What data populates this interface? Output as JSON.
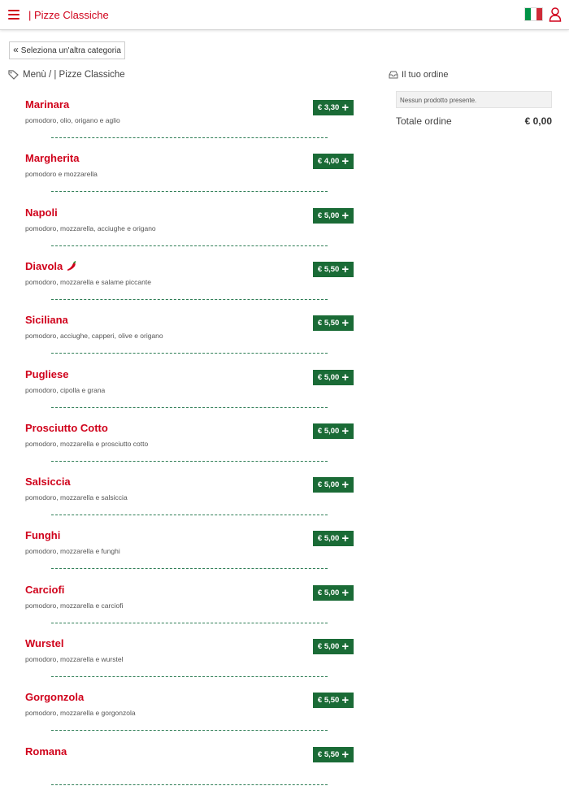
{
  "header": {
    "title": "| Pizze Classiche",
    "menu_icon": "hamburger-menu-icon",
    "flag_icon": "italian-flag-icon",
    "user_icon": "user-icon"
  },
  "category_button": {
    "chevron": "«",
    "label": "Seleziona un'altra categoria"
  },
  "breadcrumb": "Menù / | Pizze Classiche",
  "order": {
    "title": "Il tuo ordine",
    "empty_message": "Nessun prodotto presente.",
    "total_label": "Totale ordine",
    "total_value": "€ 0,00"
  },
  "colors": {
    "accent": "#d0021b",
    "price_button": "#1a6b36"
  },
  "items": [
    {
      "name": "Marinara",
      "description": "pomodoro, olio, origano e aglio",
      "price": "€ 3,30"
    },
    {
      "name": "Margherita",
      "description": "pomodoro e mozzarella",
      "price": "€ 4,00"
    },
    {
      "name": "Napoli",
      "description": "pomodoro, mozzarella, acciughe e origano",
      "price": "€ 5,00"
    },
    {
      "name": "Diavola",
      "description": "pomodoro, mozzarella e salame piccante",
      "price": "€ 5,50"
    },
    {
      "name": "Siciliana",
      "description": "pomodoro, acciughe, capperi, olive e origano",
      "price": "€ 5,50"
    },
    {
      "name": "Pugliese",
      "description": "pomodoro, cipolla e grana",
      "price": "€ 5,00"
    },
    {
      "name": "Prosciutto Cotto",
      "description": "pomodoro, mozzarella e prosciutto cotto",
      "price": "€ 5,00"
    },
    {
      "name": "Salsiccia",
      "description": "pomodoro, mozzarella e salsiccia",
      "price": "€ 5,00"
    },
    {
      "name": "Funghi",
      "description": "pomodoro, mozzarella e funghi",
      "price": "€ 5,00"
    },
    {
      "name": "Carciofi",
      "description": "pomodoro, mozzarella e carciofi",
      "price": "€ 5,00"
    },
    {
      "name": "Wurstel",
      "description": "pomodoro, mozzarella e wurstel",
      "price": "€ 5,00"
    },
    {
      "name": "Gorgonzola",
      "description": "pomodoro, mozzarella e gorgonzola",
      "price": "€ 5,50"
    },
    {
      "name": "Romana",
      "description": "",
      "price": "€ 5,50"
    }
  ]
}
